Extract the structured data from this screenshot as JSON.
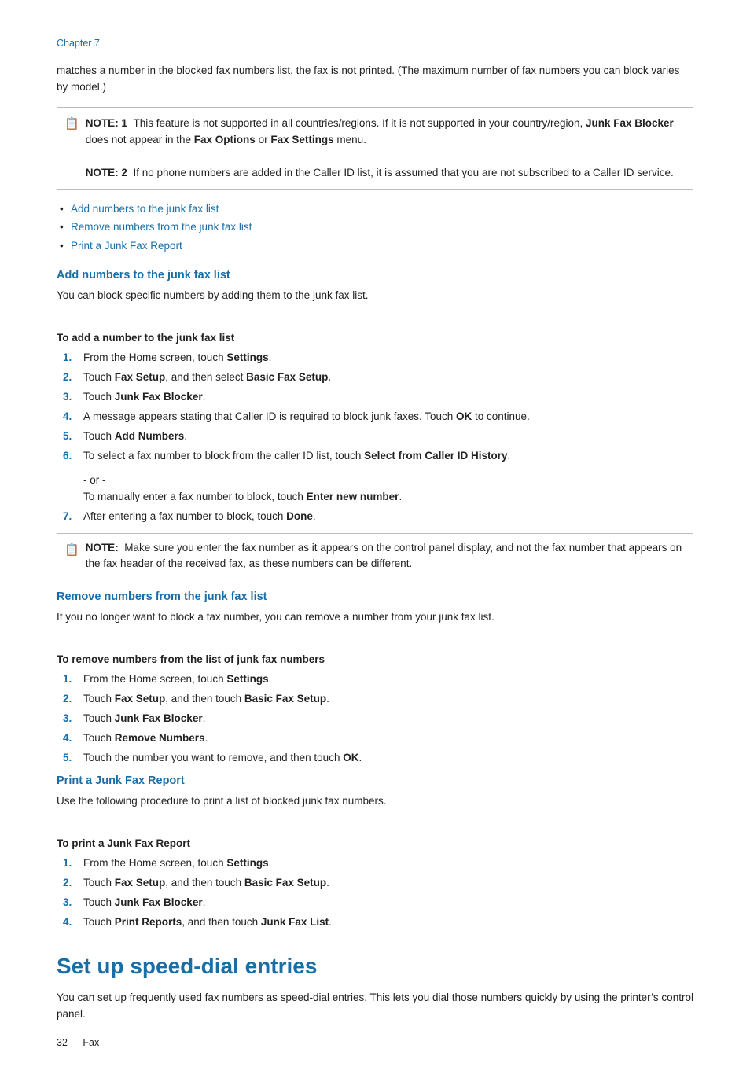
{
  "chapter": {
    "label": "Chapter 7"
  },
  "intro": {
    "text": "matches a number in the blocked fax numbers list, the fax is not printed. (The maximum number of fax numbers you can block varies by model.)"
  },
  "note1": {
    "icon": "📋",
    "label": "NOTE: 1",
    "text1": "This feature is not supported in all countries/regions. If it is not supported in your country/region,",
    "bold1": "Junk Fax Blocker",
    "text2": "does not appear in the",
    "bold2": "Fax Options",
    "text3": "or",
    "bold3": "Fax Settings",
    "text4": "menu."
  },
  "note2": {
    "label": "NOTE: 2",
    "text": "If no phone numbers are added in the Caller ID list, it is assumed that you are not subscribed to a Caller ID service."
  },
  "links": [
    {
      "text": "Add numbers to the junk fax list",
      "href": "#add"
    },
    {
      "text": "Remove numbers from the junk fax list",
      "href": "#remove"
    },
    {
      "text": "Print a Junk Fax Report",
      "href": "#print"
    }
  ],
  "sections": {
    "add": {
      "heading": "Add numbers to the junk fax list",
      "body": "You can block specific numbers by adding them to the junk fax list.",
      "subheading": "To add a number to the junk fax list",
      "steps": [
        {
          "num": "1.",
          "text": "From the Home screen, touch ",
          "bold": "Settings",
          "after": "."
        },
        {
          "num": "2.",
          "text": "Touch ",
          "bold": "Fax Setup",
          "mid": ", and then select ",
          "bold2": "Basic Fax Setup",
          "after": "."
        },
        {
          "num": "3.",
          "text": "Touch ",
          "bold": "Junk Fax Blocker",
          "after": "."
        },
        {
          "num": "4.",
          "text": "A message appears stating that Caller ID is required to block junk faxes. Touch ",
          "bold": "OK",
          "after": " to continue."
        },
        {
          "num": "5.",
          "text": "Touch ",
          "bold": "Add Numbers",
          "after": "."
        },
        {
          "num": "6.",
          "text": "To select a fax number to block from the caller ID list, touch ",
          "bold": "Select from Caller ID History",
          "after": "."
        }
      ],
      "or_text": "- or -",
      "or_line2": "To manually enter a fax number to block, touch ",
      "or_bold": "Enter new number",
      "or_after": ".",
      "step7": {
        "num": "7.",
        "text": "After entering a fax number to block, touch ",
        "bold": "Done",
        "after": "."
      },
      "note": "Make sure you enter the fax number as it appears on the control panel display, and not the fax number that appears on the fax header of the received fax, as these numbers can be different."
    },
    "remove": {
      "heading": "Remove numbers from the junk fax list",
      "body": "If you no longer want to block a fax number, you can remove a number from your junk fax list.",
      "subheading": "To remove numbers from the list of junk fax numbers",
      "steps": [
        {
          "num": "1.",
          "text": "From the Home screen, touch ",
          "bold": "Settings",
          "after": "."
        },
        {
          "num": "2.",
          "text": "Touch ",
          "bold": "Fax Setup",
          "mid": ", and then touch ",
          "bold2": "Basic Fax Setup",
          "after": "."
        },
        {
          "num": "3.",
          "text": "Touch ",
          "bold": "Junk Fax Blocker",
          "after": "."
        },
        {
          "num": "4.",
          "text": "Touch ",
          "bold": "Remove Numbers",
          "after": "."
        },
        {
          "num": "5.",
          "text": "Touch the number you want to remove, and then touch ",
          "bold": "OK",
          "after": "."
        }
      ]
    },
    "print": {
      "heading": "Print a Junk Fax Report",
      "body": "Use the following procedure to print a list of blocked junk fax numbers.",
      "subheading": "To print a Junk Fax Report",
      "steps": [
        {
          "num": "1.",
          "text": "From the Home screen, touch ",
          "bold": "Settings",
          "after": "."
        },
        {
          "num": "2.",
          "text": "Touch ",
          "bold": "Fax Setup",
          "mid": ", and then touch ",
          "bold2": "Basic Fax Setup",
          "after": "."
        },
        {
          "num": "3.",
          "text": "Touch ",
          "bold": "Junk Fax Blocker",
          "after": "."
        },
        {
          "num": "4.",
          "text": "Touch ",
          "bold": "Print Reports",
          "mid": ", and then touch ",
          "bold2": "Junk Fax List",
          "after": "."
        }
      ]
    }
  },
  "big_section": {
    "heading": "Set up speed-dial entries",
    "body": "You can set up frequently used fax numbers as speed-dial entries. This lets you dial those numbers quickly by using the printer’s control panel."
  },
  "footer": {
    "page": "32",
    "label": "Fax"
  }
}
